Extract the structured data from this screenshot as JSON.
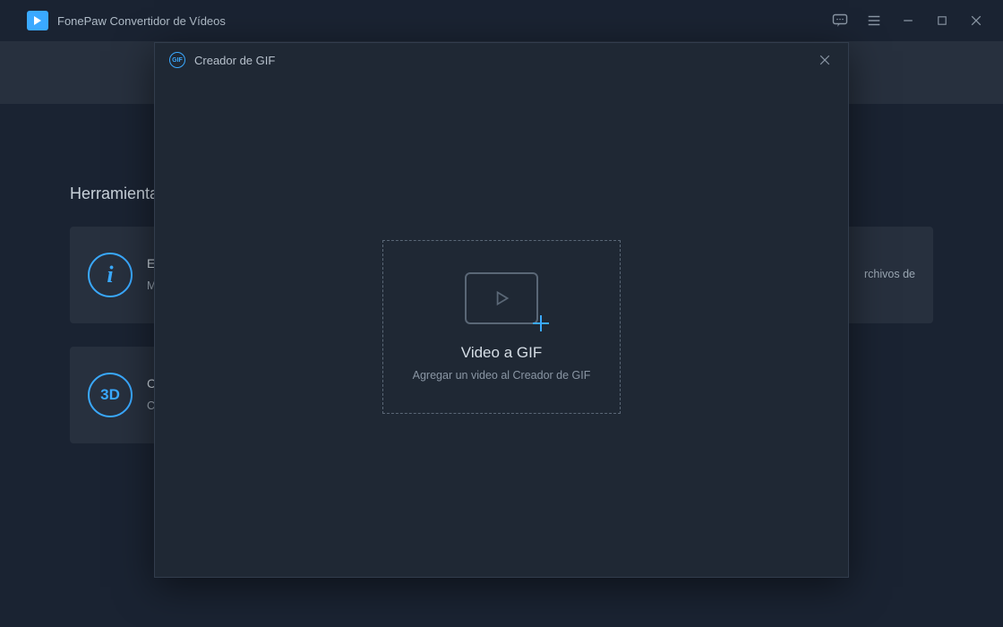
{
  "app": {
    "title": "FonePaw Convertidor de Vídeos"
  },
  "main": {
    "section_title": "Herramientas",
    "cards": {
      "editor": {
        "title_short": "E",
        "description_short": "M\na\nd"
      },
      "compressor": {
        "description_short": "rchivos de"
      },
      "c3d": {
        "title_short": "C",
        "icon_label": "3D",
        "description_short": "C\nd"
      }
    }
  },
  "modal": {
    "badge_text": "GIF",
    "title": "Creador de GIF",
    "dropzone": {
      "title": "Video a GIF",
      "subtitle": "Agregar un video al Creador de GIF"
    }
  }
}
